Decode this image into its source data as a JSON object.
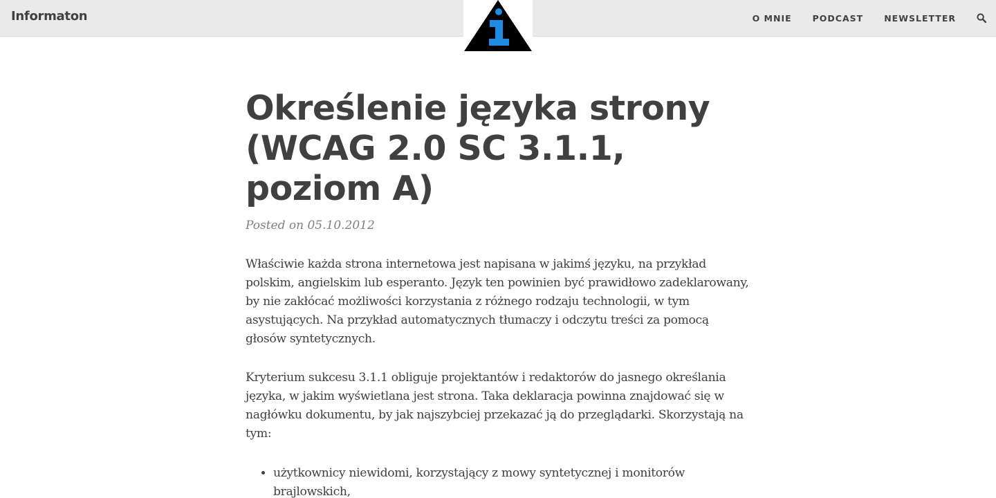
{
  "header": {
    "brand": "Informaton",
    "nav": [
      "O MNIE",
      "PODCAST",
      "NEWSLETTER"
    ],
    "search_icon": "search-icon",
    "logo_icon": "info-triangle-logo-icon"
  },
  "colors": {
    "topbar_bg": "#eaeaea",
    "text": "#404040",
    "meta": "#808080",
    "logo_blue": "#1e8ce3",
    "logo_black": "#000000"
  },
  "article": {
    "title": "Określenie języka strony (WCAG 2.0 SC 3.1.1, poziom A)",
    "meta": "Posted on 05.10.2012",
    "paragraphs": [
      "Właściwie każda strona internetowa jest napisana w jakimś języku, na przykład polskim, angielskim lub esperanto. Język ten powinien być prawidłowo zadeklarowany, by nie zakłócać możliwości korzystania z różnego rodzaju technologii, w tym asystujących. Na przykład automatycznych tłumaczy i odczytu treści za pomocą głosów syntetycznych.",
      "Kryterium sukcesu 3.1.1 obliguje projektantów i redaktorów do jasnego określania języka, w jakim wyświetlana jest strona. Taka deklaracja powinna znajdować się w nagłówku dokumentu, by jak najszybciej przekazać ją do przeglądarki. Skorzystają na tym:"
    ],
    "list": [
      "użytkownicy niewidomi, korzystający z mowy syntetycznej i monitorów brajlowskich,"
    ]
  }
}
